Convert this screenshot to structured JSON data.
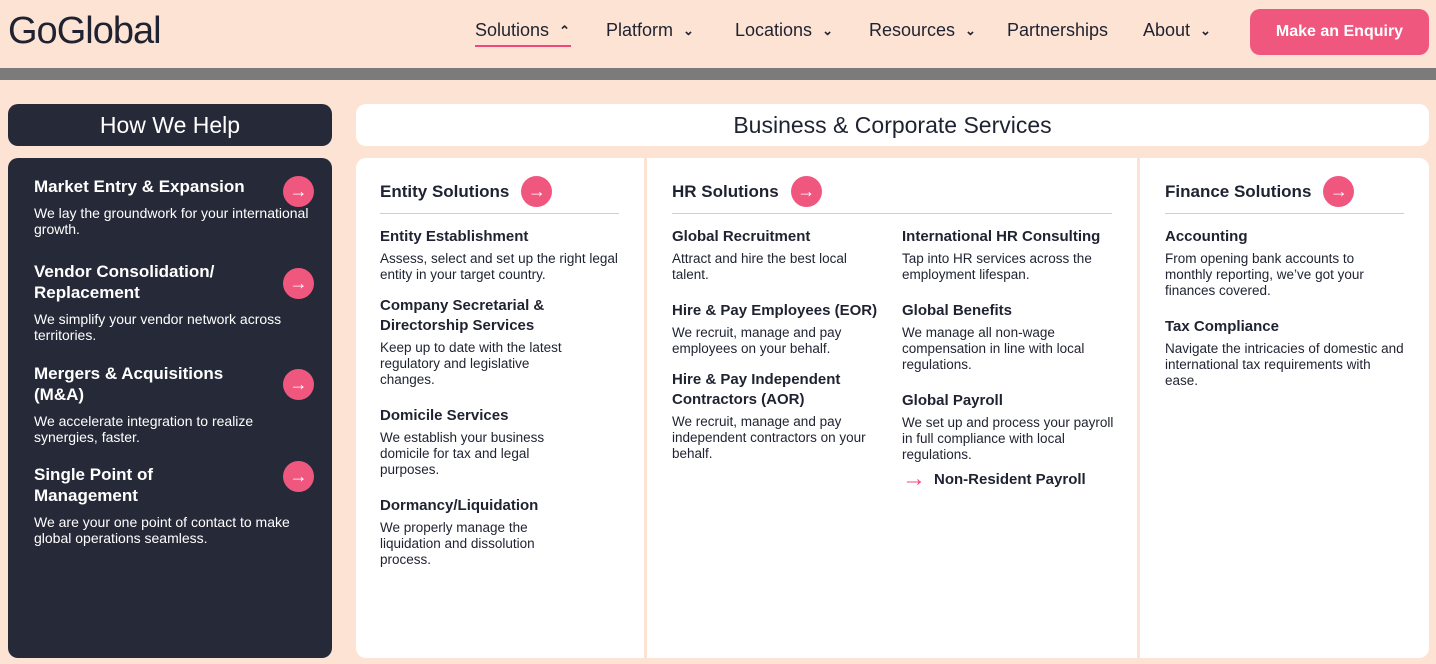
{
  "header": {
    "logo": "GoGlobal",
    "nav": [
      {
        "label": "Solutions",
        "chevron": "^"
      },
      {
        "label": "Platform",
        "chevron": "v"
      },
      {
        "label": "Locations",
        "chevron": "v"
      },
      {
        "label": "Resources",
        "chevron": "v"
      },
      {
        "label": "Partnerships"
      },
      {
        "label": "About",
        "chevron": "v"
      }
    ],
    "cta": "Make an Enquiry"
  },
  "sidebar": {
    "title": "How We Help",
    "items": [
      {
        "title": "Market Entry & Expansion",
        "desc": "We lay the groundwork for your international growth."
      },
      {
        "title": "Vendor Consolidation/ Replacement",
        "desc": "We simplify your vendor network across territories."
      },
      {
        "title": "Mergers & Acquisitions (M&A)",
        "desc": "We accelerate integration to realize synergies, faster."
      },
      {
        "title": "Single Point of Management",
        "desc": "We are your one point of contact to make global operations seamless."
      }
    ]
  },
  "main": {
    "title": "Business & Corporate Services",
    "entity": {
      "heading": "Entity Solutions",
      "items": [
        {
          "title": "Entity Establishment",
          "desc": "Assess, select and set up the right legal entity in your target country."
        },
        {
          "title": "Company Secretarial & Directorship Services",
          "desc": "Keep up to date with the latest regulatory and legislative changes."
        },
        {
          "title": "Domicile Services",
          "desc": "We establish your business domicile for tax and legal purposes."
        },
        {
          "title": "Dormancy/Liquidation",
          "desc": "We properly manage the liquidation and dissolution process."
        }
      ]
    },
    "hr": {
      "heading": "HR Solutions",
      "left": [
        {
          "title": "Global Recruitment",
          "desc": "Attract and hire the best local talent."
        },
        {
          "title": "Hire & Pay Employees (EOR)",
          "desc": "We recruit, manage and pay employees on your behalf."
        },
        {
          "title": "Hire & Pay Independent Contractors (AOR)",
          "desc": "We recruit, manage and pay independent contractors on your behalf."
        }
      ],
      "right": [
        {
          "title": "International HR Consulting",
          "desc": "Tap into HR services across the employment lifespan."
        },
        {
          "title": "Global Benefits",
          "desc": "We manage all non-wage compensation in line with local regulations."
        },
        {
          "title": "Global Payroll",
          "desc": "We set up and process your payroll in full compliance with local regulations."
        }
      ],
      "sublink": "Non-Resident Payroll"
    },
    "finance": {
      "heading": "Finance Solutions",
      "items": [
        {
          "title": "Accounting",
          "desc": "From opening bank accounts to monthly reporting, we’ve got your finances covered."
        },
        {
          "title": "Tax Compliance",
          "desc": "Navigate the intricacies of domestic and international tax requirements with ease."
        }
      ]
    }
  },
  "colors": {
    "accent": "#f0577f",
    "dark": "#262a38",
    "background": "#fde3d3",
    "divider": "#7b7b7b"
  },
  "icons": {
    "arrow": "arrow-right-icon",
    "chevron_down": "chevron-down-icon",
    "chevron_up": "chevron-up-icon"
  }
}
